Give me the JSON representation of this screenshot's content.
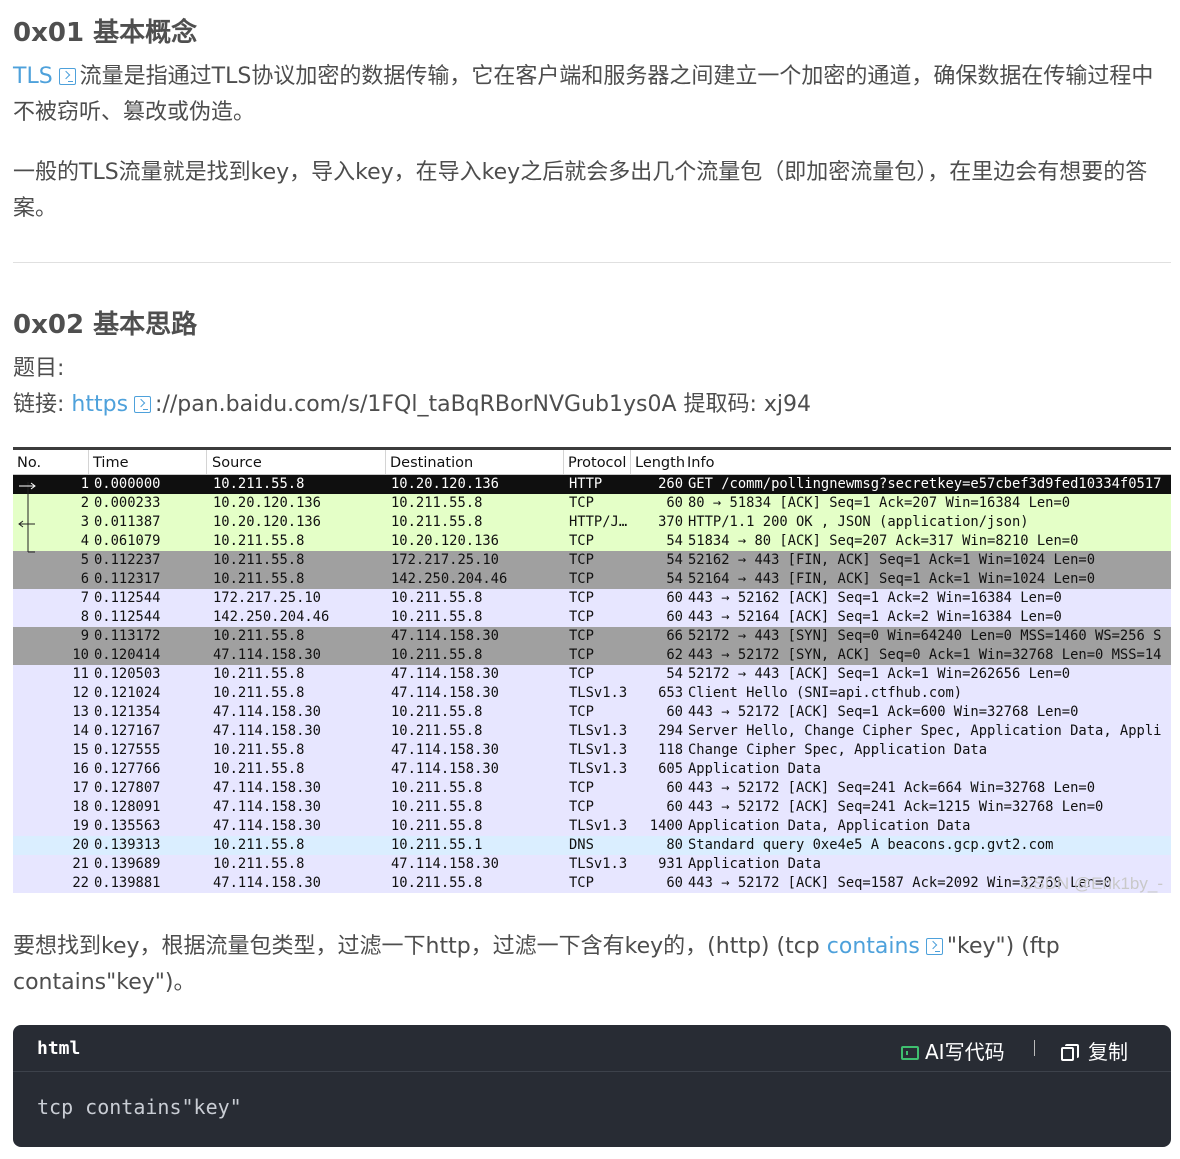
{
  "section1": {
    "title": "0x01 基本概念",
    "p1_link": "TLS",
    "p1_text": "流量是指通过TLS协议加密的数据传输，它在客户端和服务器之间建立一个加密的通道，确保数据在传输过程中不被窃听、篡改或伪造。",
    "p2_text": "一般的TLS流量就是找到key，导入key，在导入key之后就会多出几个流量包（即加密流量包），在里边会有想要的答案。"
  },
  "section2": {
    "title": "0x02 基本思路",
    "topic_label": "题目:",
    "link_prefix": "链接:",
    "link_text": "https",
    "link_rest": "://pan.baidu.com/s/1FQl_taBqRBorNVGub1ys0A 提取码: xj94",
    "filter_text_1": "要想找到key，根据流量包类型，过滤一下http，过滤一下含有key的，(http) (tcp ",
    "filter_link": "contains",
    "filter_text_2": "\"key\") (ftp contains\"key\")。"
  },
  "packets": {
    "headers": {
      "no": "No.",
      "time": "Time",
      "source": "Source",
      "destination": "Destination",
      "protocol": "Protocol",
      "length": "Length",
      "info": "Info"
    },
    "rows": [
      {
        "no": "1",
        "time": "0.000000",
        "src": "10.211.55.8",
        "dst": "10.20.120.136",
        "proto": "HTTP",
        "len": "260",
        "info": "GET /comm/pollingnewmsg?secretkey=e57cbef3d9fed10334f0517",
        "color": "sel"
      },
      {
        "no": "2",
        "time": "0.000233",
        "src": "10.20.120.136",
        "dst": "10.211.55.8",
        "proto": "TCP",
        "len": "60",
        "info": "80 → 51834 [ACK] Seq=1 Ack=207 Win=16384 Len=0",
        "color": "http"
      },
      {
        "no": "3",
        "time": "0.011387",
        "src": "10.20.120.136",
        "dst": "10.211.55.8",
        "proto": "HTTP/J…",
        "len": "370",
        "info": "HTTP/1.1 200 OK , JSON (application/json)",
        "color": "http"
      },
      {
        "no": "4",
        "time": "0.061079",
        "src": "10.211.55.8",
        "dst": "10.20.120.136",
        "proto": "TCP",
        "len": "54",
        "info": "51834 → 80 [ACK] Seq=207 Ack=317 Win=8210 Len=0",
        "color": "http"
      },
      {
        "no": "5",
        "time": "0.112237",
        "src": "10.211.55.8",
        "dst": "172.217.25.10",
        "proto": "TCP",
        "len": "54",
        "info": "52162 → 443 [FIN, ACK] Seq=1 Ack=1 Win=1024 Len=0",
        "color": "gray"
      },
      {
        "no": "6",
        "time": "0.112317",
        "src": "10.211.55.8",
        "dst": "142.250.204.46",
        "proto": "TCP",
        "len": "54",
        "info": "52164 → 443 [FIN, ACK] Seq=1 Ack=1 Win=1024 Len=0",
        "color": "gray"
      },
      {
        "no": "7",
        "time": "0.112544",
        "src": "172.217.25.10",
        "dst": "10.211.55.8",
        "proto": "TCP",
        "len": "60",
        "info": "443 → 52162 [ACK] Seq=1 Ack=2 Win=16384 Len=0",
        "color": "tcp"
      },
      {
        "no": "8",
        "time": "0.112544",
        "src": "142.250.204.46",
        "dst": "10.211.55.8",
        "proto": "TCP",
        "len": "60",
        "info": "443 → 52164 [ACK] Seq=1 Ack=2 Win=16384 Len=0",
        "color": "tcp"
      },
      {
        "no": "9",
        "time": "0.113172",
        "src": "10.211.55.8",
        "dst": "47.114.158.30",
        "proto": "TCP",
        "len": "66",
        "info": "52172 → 443 [SYN] Seq=0 Win=64240 Len=0 MSS=1460 WS=256 S",
        "color": "gray"
      },
      {
        "no": "10",
        "time": "0.120414",
        "src": "47.114.158.30",
        "dst": "10.211.55.8",
        "proto": "TCP",
        "len": "62",
        "info": "443 → 52172 [SYN, ACK] Seq=0 Ack=1 Win=32768 Len=0 MSS=14",
        "color": "gray"
      },
      {
        "no": "11",
        "time": "0.120503",
        "src": "10.211.55.8",
        "dst": "47.114.158.30",
        "proto": "TCP",
        "len": "54",
        "info": "52172 → 443 [ACK] Seq=1 Ack=1 Win=262656 Len=0",
        "color": "tcp"
      },
      {
        "no": "12",
        "time": "0.121024",
        "src": "10.211.55.8",
        "dst": "47.114.158.30",
        "proto": "TLSv1.3",
        "len": "653",
        "info": "Client Hello (SNI=api.ctfhub.com)",
        "color": "tcp"
      },
      {
        "no": "13",
        "time": "0.121354",
        "src": "47.114.158.30",
        "dst": "10.211.55.8",
        "proto": "TCP",
        "len": "60",
        "info": "443 → 52172 [ACK] Seq=1 Ack=600 Win=32768 Len=0",
        "color": "tcp"
      },
      {
        "no": "14",
        "time": "0.127167",
        "src": "47.114.158.30",
        "dst": "10.211.55.8",
        "proto": "TLSv1.3",
        "len": "294",
        "info": "Server Hello, Change Cipher Spec, Application Data, Appli",
        "color": "tcp"
      },
      {
        "no": "15",
        "time": "0.127555",
        "src": "10.211.55.8",
        "dst": "47.114.158.30",
        "proto": "TLSv1.3",
        "len": "118",
        "info": "Change Cipher Spec, Application Data",
        "color": "tcp"
      },
      {
        "no": "16",
        "time": "0.127766",
        "src": "10.211.55.8",
        "dst": "47.114.158.30",
        "proto": "TLSv1.3",
        "len": "605",
        "info": "Application Data",
        "color": "tcp"
      },
      {
        "no": "17",
        "time": "0.127807",
        "src": "47.114.158.30",
        "dst": "10.211.55.8",
        "proto": "TCP",
        "len": "60",
        "info": "443 → 52172 [ACK] Seq=241 Ack=664 Win=32768 Len=0",
        "color": "tcp"
      },
      {
        "no": "18",
        "time": "0.128091",
        "src": "47.114.158.30",
        "dst": "10.211.55.8",
        "proto": "TCP",
        "len": "60",
        "info": "443 → 52172 [ACK] Seq=241 Ack=1215 Win=32768 Len=0",
        "color": "tcp"
      },
      {
        "no": "19",
        "time": "0.135563",
        "src": "47.114.158.30",
        "dst": "10.211.55.8",
        "proto": "TLSv1.3",
        "len": "1400",
        "info": "Application Data, Application Data",
        "color": "tcp"
      },
      {
        "no": "20",
        "time": "0.139313",
        "src": "10.211.55.8",
        "dst": "10.211.55.1",
        "proto": "DNS",
        "len": "80",
        "info": "Standard query 0xe4e5 A beacons.gcp.gvt2.com",
        "color": "dns"
      },
      {
        "no": "21",
        "time": "0.139689",
        "src": "10.211.55.8",
        "dst": "47.114.158.30",
        "proto": "TLSv1.3",
        "len": "931",
        "info": "Application Data",
        "color": "tcp"
      },
      {
        "no": "22",
        "time": "0.139881",
        "src": "47.114.158.30",
        "dst": "10.211.55.8",
        "proto": "TCP",
        "len": "60",
        "info": "443 → 52172 [ACK] Seq=1587 Ack=2092 Win=32768 Len=0",
        "color": "tcp"
      }
    ],
    "watermark": "CSDN @Enk1by_-"
  },
  "code_block": {
    "language": "html",
    "ai_label": "AI写代码",
    "copy_label": "复制",
    "code": "tcp contains\"key\""
  }
}
